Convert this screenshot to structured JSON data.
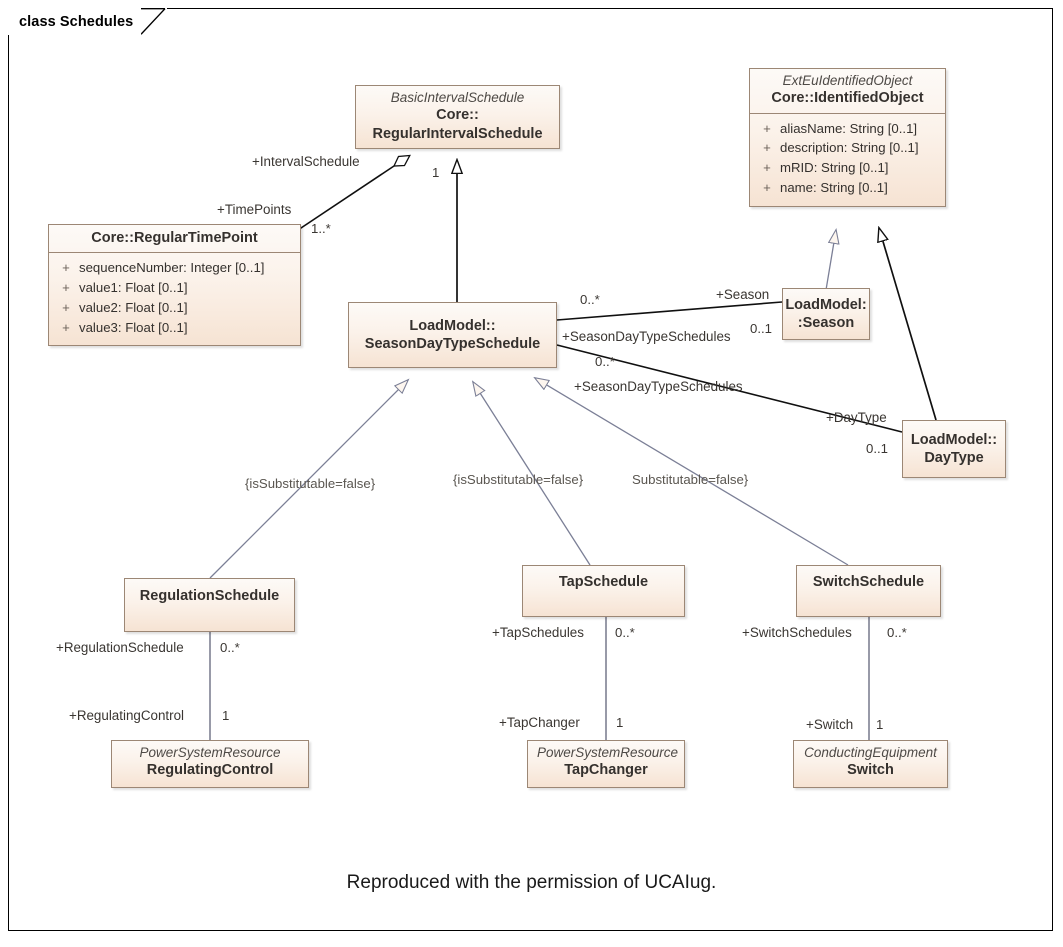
{
  "diagram": {
    "tab_label": "class Schedules",
    "caption": "Reproduced with the permission of UCAIug.",
    "colors": {
      "box_fill_top": "#fdfaf7",
      "box_fill_bottom": "#f6e3d3",
      "box_border": "#9c8775",
      "text": "#35312e",
      "generalization_gray": "#7b7f96",
      "association_black": "#1a1a1a"
    }
  },
  "classes": {
    "regular_interval_schedule": {
      "stereotype": "BasicIntervalSchedule",
      "namespace": "Core::",
      "name": "RegularIntervalSchedule"
    },
    "identified_object": {
      "stereotype": "ExtEuIdentifiedObject",
      "namespace": "Core::",
      "name": "IdentifiedObject",
      "attributes": [
        {
          "visibility": "+",
          "signature": "aliasName: String [0..1]"
        },
        {
          "visibility": "+",
          "signature": "description: String [0..1]"
        },
        {
          "visibility": "+",
          "signature": "mRID: String [0..1]"
        },
        {
          "visibility": "+",
          "signature": "name: String [0..1]"
        }
      ]
    },
    "regular_time_point": {
      "namespace": "Core::",
      "name": "RegularTimePoint",
      "attributes": [
        {
          "visibility": "+",
          "signature": "sequenceNumber: Integer [0..1]"
        },
        {
          "visibility": "+",
          "signature": "value1: Float [0..1]"
        },
        {
          "visibility": "+",
          "signature": "value2: Float [0..1]"
        },
        {
          "visibility": "+",
          "signature": "value3: Float [0..1]"
        }
      ]
    },
    "season_day_type_schedule": {
      "namespace": "LoadModel::",
      "name": "SeasonDayTypeSchedule"
    },
    "season": {
      "namespace": "LoadModel:",
      "name": ":Season"
    },
    "day_type": {
      "namespace": "LoadModel::",
      "name": "DayType"
    },
    "regulation_schedule": {
      "name": "RegulationSchedule"
    },
    "tap_schedule": {
      "name": "TapSchedule"
    },
    "switch_schedule": {
      "name": "SwitchSchedule"
    },
    "regulating_control": {
      "stereotype": "PowerSystemResource",
      "name": "RegulatingControl"
    },
    "tap_changer": {
      "stereotype": "PowerSystemResource",
      "name": "TapChanger"
    },
    "switch": {
      "stereotype": "ConductingEquipment",
      "name": "Switch"
    }
  },
  "labels": {
    "interval_schedule_role": "+IntervalSchedule",
    "interval_schedule_mult": "1",
    "time_points_role": "+TimePoints",
    "time_points_mult": "1..*",
    "season_sched_mult_top": "0..*",
    "season_role": "+Season",
    "season_mult": "0..1",
    "season_day_type_schedules_top": "+SeasonDayTypeSchedules",
    "season_sched_mult_bottom": "0..*",
    "season_day_type_schedules_bottom": "+SeasonDayTypeSchedules",
    "day_type_role": "+DayType",
    "day_type_mult": "0..1",
    "constraint_left": "{isSubstitutable=false}",
    "constraint_mid": "{isSubstitutable=false}",
    "constraint_right": "Substitutable=false}",
    "regulation_schedule_role": "+RegulationSchedule",
    "regulation_schedule_mult": "0..*",
    "regulating_control_role": "+RegulatingControl",
    "regulating_control_mult": "1",
    "tap_schedules_role": "+TapSchedules",
    "tap_schedules_mult": "0..*",
    "tap_changer_role": "+TapChanger",
    "tap_changer_mult": "1",
    "switch_schedules_role": "+SwitchSchedules",
    "switch_schedules_mult": "0..*",
    "switch_role": "+Switch",
    "switch_mult": "1"
  }
}
